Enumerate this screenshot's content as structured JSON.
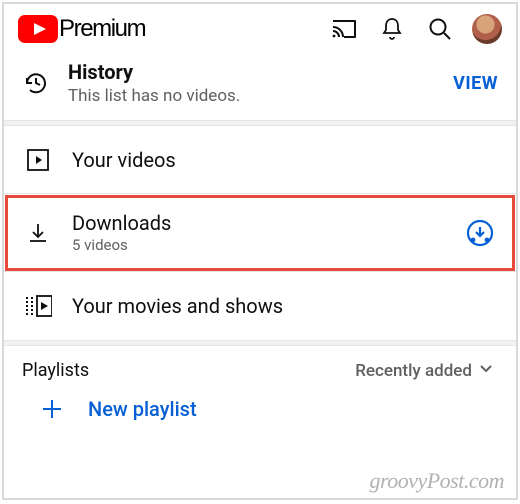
{
  "header": {
    "brand": "Premium"
  },
  "history": {
    "title": "History",
    "subtitle": "This list has no videos.",
    "action": "VIEW"
  },
  "library": {
    "your_videos": {
      "title": "Your videos"
    },
    "downloads": {
      "title": "Downloads",
      "subtitle": "5 videos"
    },
    "movies_shows": {
      "title": "Your movies and shows"
    }
  },
  "playlists": {
    "label": "Playlists",
    "sort": "Recently added",
    "new_label": "New playlist"
  },
  "watermark": "groovyPost.com"
}
